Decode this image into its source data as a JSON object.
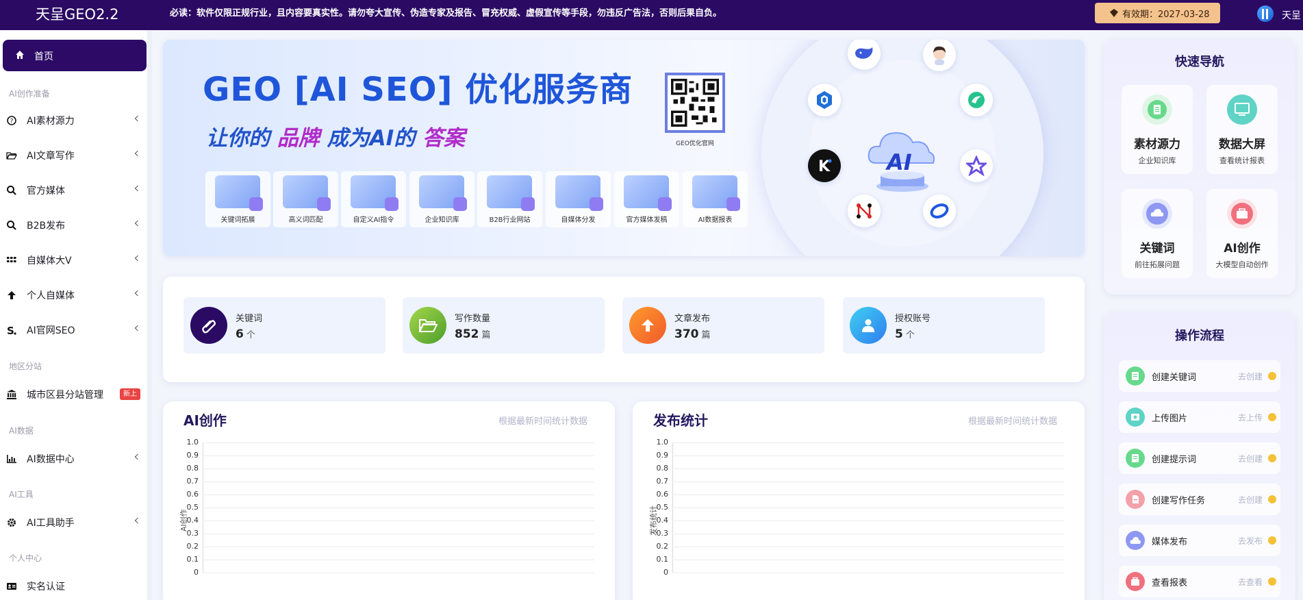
{
  "topbar": {
    "logo": "天呈GEO2.2",
    "notice": "必读：软件仅限正规行业，且内容要真实性。请勿夸大宣传、伪造专家及报告、冒充权威、虚假宣传等手段，勿违反广告法，否则后果自负。",
    "expiry": "有效期：2027-03-28",
    "user": "天呈"
  },
  "sidebar": {
    "home": "首页",
    "sections": {
      "ai_prep": "AI创作准备",
      "region": "地区分站",
      "ai_data": "AI数据",
      "ai_tools": "AI工具",
      "personal": "个人中心"
    },
    "items": {
      "material": "AI素材源力",
      "article": "AI文章写作",
      "official_media": "官方媒体",
      "b2b": "B2B发布",
      "self_media": "自媒体大V",
      "personal_media": "个人自媒体",
      "seo": "AI官网SEO",
      "city_station": "城市区县分站管理",
      "data_center": "AI数据中心",
      "tool_helper": "AI工具助手",
      "verify": "实名认证"
    },
    "new_badge": "新上"
  },
  "banner": {
    "title": "GEO [AI SEO] 优化服务商",
    "sub_a": "让你的",
    "sub_b": "品牌",
    "sub_c": "成为AI的",
    "sub_d": "答案",
    "qr_caption": "GEO优化官网",
    "ai_label": "AI",
    "thumbs": [
      "关键词拓展",
      "高义词匹配",
      "自定义AI指令",
      "企业知识库",
      "B2B行业网站",
      "自媒体分发",
      "官方媒体发稿",
      "AI数据报表"
    ]
  },
  "stats": [
    {
      "label": "关键词",
      "value": "6",
      "unit": "个"
    },
    {
      "label": "写作数量",
      "value": "852",
      "unit": "篇"
    },
    {
      "label": "文章发布",
      "value": "370",
      "unit": "篇"
    },
    {
      "label": "授权账号",
      "value": "5",
      "unit": "个"
    }
  ],
  "panels": {
    "ai": {
      "title": "AI创作",
      "note": "根据最新时间统计数据",
      "ylabel": "AI创作"
    },
    "publish": {
      "title": "发布统计",
      "note": "根据最新时间统计数据",
      "ylabel": "发布统计"
    }
  },
  "chart_data": [
    {
      "type": "line",
      "title": "AI创作",
      "ylabel": "AI创作",
      "ylim": [
        0,
        1.0
      ],
      "y_ticks": [
        "1.0",
        "0.9",
        "0.8",
        "0.7",
        "0.6",
        "0.5",
        "0.4",
        "0.3",
        "0.2",
        "0.1",
        "0"
      ],
      "series": []
    },
    {
      "type": "line",
      "title": "发布统计",
      "ylabel": "发布统计",
      "ylim": [
        0,
        1.0
      ],
      "y_ticks": [
        "1.0",
        "0.9",
        "0.8",
        "0.7",
        "0.6",
        "0.5",
        "0.4",
        "0.3",
        "0.2",
        "0.1",
        "0"
      ],
      "series": []
    }
  ],
  "quick_nav": {
    "title": "快速导航",
    "items": [
      {
        "title": "素材源力",
        "sub": "企业知识库"
      },
      {
        "title": "数据大屏",
        "sub": "查看统计报表"
      },
      {
        "title": "关键词",
        "sub": "前往拓展问题"
      },
      {
        "title": "AI创作",
        "sub": "大模型自动创作"
      }
    ]
  },
  "workflow": {
    "title": "操作流程",
    "items": [
      {
        "label": "创建关键词",
        "action": "去创建"
      },
      {
        "label": "上传图片",
        "action": "去上传"
      },
      {
        "label": "创建提示词",
        "action": "去创建"
      },
      {
        "label": "创建写作任务",
        "action": "去创建"
      },
      {
        "label": "媒体发布",
        "action": "去发布"
      },
      {
        "label": "查看报表",
        "action": "去查看"
      }
    ]
  },
  "colors": {
    "topbar": "#2a0a63",
    "accent": "#7e6bf3",
    "expiry_bg": "#f4c28c",
    "badge": "#e94343"
  }
}
